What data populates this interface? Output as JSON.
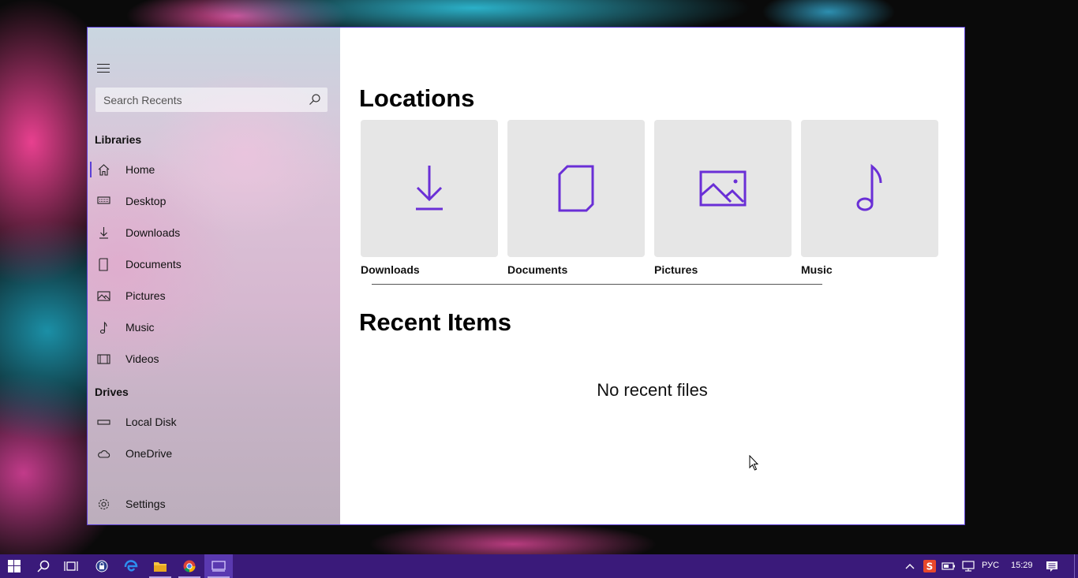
{
  "sidebar": {
    "search_placeholder": "Search Recents",
    "libraries_heading": "Libraries",
    "libraries": [
      {
        "label": "Home",
        "icon": "home-icon"
      },
      {
        "label": "Desktop",
        "icon": "desktop-icon"
      },
      {
        "label": "Downloads",
        "icon": "download-icon"
      },
      {
        "label": "Documents",
        "icon": "document-icon"
      },
      {
        "label": "Pictures",
        "icon": "picture-icon"
      },
      {
        "label": "Music",
        "icon": "music-icon"
      },
      {
        "label": "Videos",
        "icon": "video-icon"
      }
    ],
    "drives_heading": "Drives",
    "drives": [
      {
        "label": "Local Disk",
        "icon": "disk-icon"
      },
      {
        "label": "OneDrive",
        "icon": "cloud-icon"
      }
    ],
    "settings_label": "Settings"
  },
  "main": {
    "locations_heading": "Locations",
    "locations": [
      {
        "label": "Downloads",
        "icon": "download-icon"
      },
      {
        "label": "Documents",
        "icon": "document-icon"
      },
      {
        "label": "Pictures",
        "icon": "picture-icon"
      },
      {
        "label": "Music",
        "icon": "music-icon"
      }
    ],
    "recent_heading": "Recent Items",
    "empty_message": "No recent files"
  },
  "taskbar": {
    "language": "РУС",
    "time": "15:29"
  },
  "colors": {
    "accent": "#6a2fd6",
    "taskbar": "#3a1a7a"
  }
}
